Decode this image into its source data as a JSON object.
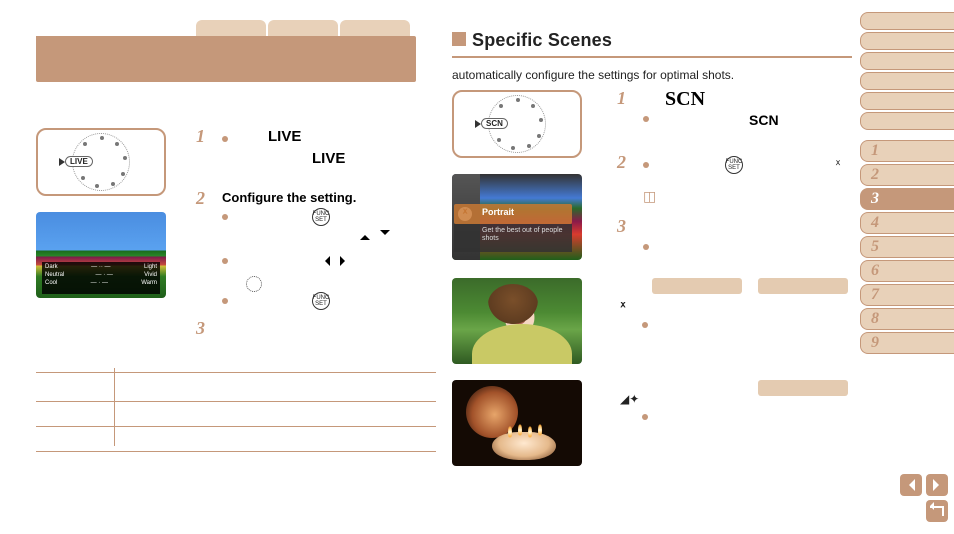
{
  "left": {
    "dial_label": "LIVE",
    "steps": [
      {
        "num": "1",
        "bold": "LIVE",
        "boldIndent": "LIVE"
      },
      {
        "num": "2",
        "bold": "Configure the setting."
      },
      {
        "num": "3",
        "bold": ""
      }
    ],
    "overlay": {
      "r1": {
        "l": "Dark",
        "r": "Light"
      },
      "r2": {
        "l": "Neutral",
        "r": "Vivid"
      },
      "r3": {
        "l": "Cool",
        "r": "Warm"
      }
    },
    "func_label": "FUNC\nSET"
  },
  "right": {
    "heading": "Specific Scenes",
    "subline": "automatically configure the settings for optimal shots.",
    "dial_label": "SCN",
    "steps": {
      "s1": {
        "num": "1",
        "big": "SCN",
        "label": "SCN"
      },
      "s2": {
        "num": "2"
      },
      "s3": {
        "num": "3"
      }
    },
    "menu_sel": "Portrait",
    "menu_sub": "Get the best out of people shots",
    "func_label": "FUNC\nSET"
  },
  "sidebar": {
    "chapters": [
      "1",
      "2",
      "3",
      "4",
      "5",
      "6",
      "7",
      "8",
      "9"
    ],
    "active": "3"
  }
}
